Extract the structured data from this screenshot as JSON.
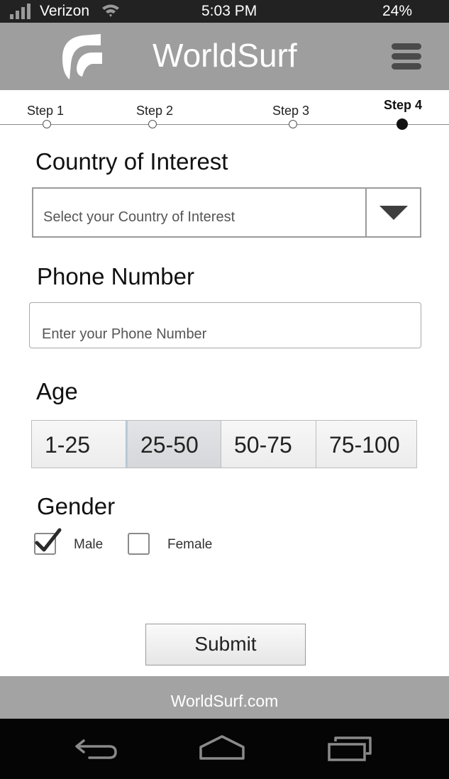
{
  "status_bar": {
    "carrier": "Verizon",
    "time": "5:03 PM",
    "battery": "24%",
    "icons": [
      "signal-icon",
      "wifi-icon"
    ]
  },
  "header": {
    "title": "WorldSurf",
    "icons": [
      "logo-icon",
      "menu-icon"
    ]
  },
  "steps": {
    "items": [
      {
        "label": "Step 1",
        "state": "inactive"
      },
      {
        "label": "Step 2",
        "state": "inactive"
      },
      {
        "label": "Step 3",
        "state": "inactive"
      },
      {
        "label": "Step 4",
        "state": "active"
      }
    ],
    "current": 4
  },
  "form": {
    "country": {
      "label": "Country of Interest",
      "placeholder": "Select your Country of Interest",
      "icon": "dropdown-arrow-icon"
    },
    "phone": {
      "label": "Phone Number",
      "placeholder": "Enter your Phone Number",
      "value": ""
    },
    "age": {
      "label": "Age",
      "options": [
        "1-25",
        "25-50",
        "50-75",
        "75-100"
      ],
      "selected": "25-50"
    },
    "gender": {
      "label": "Gender",
      "options": [
        {
          "label": "Male",
          "checked": true
        },
        {
          "label": "Female",
          "checked": false
        }
      ]
    },
    "submit_label": "Submit"
  },
  "footer": {
    "text": "WorldSurf.com"
  },
  "nav_bar": {
    "icons": [
      "back-icon",
      "home-icon",
      "recent-apps-icon"
    ]
  },
  "colors": {
    "status_bar": "#222222",
    "header": "#9e9e9e",
    "footer": "#a3a3a3",
    "nav_bar": "#050505",
    "active_step": "#111111"
  }
}
